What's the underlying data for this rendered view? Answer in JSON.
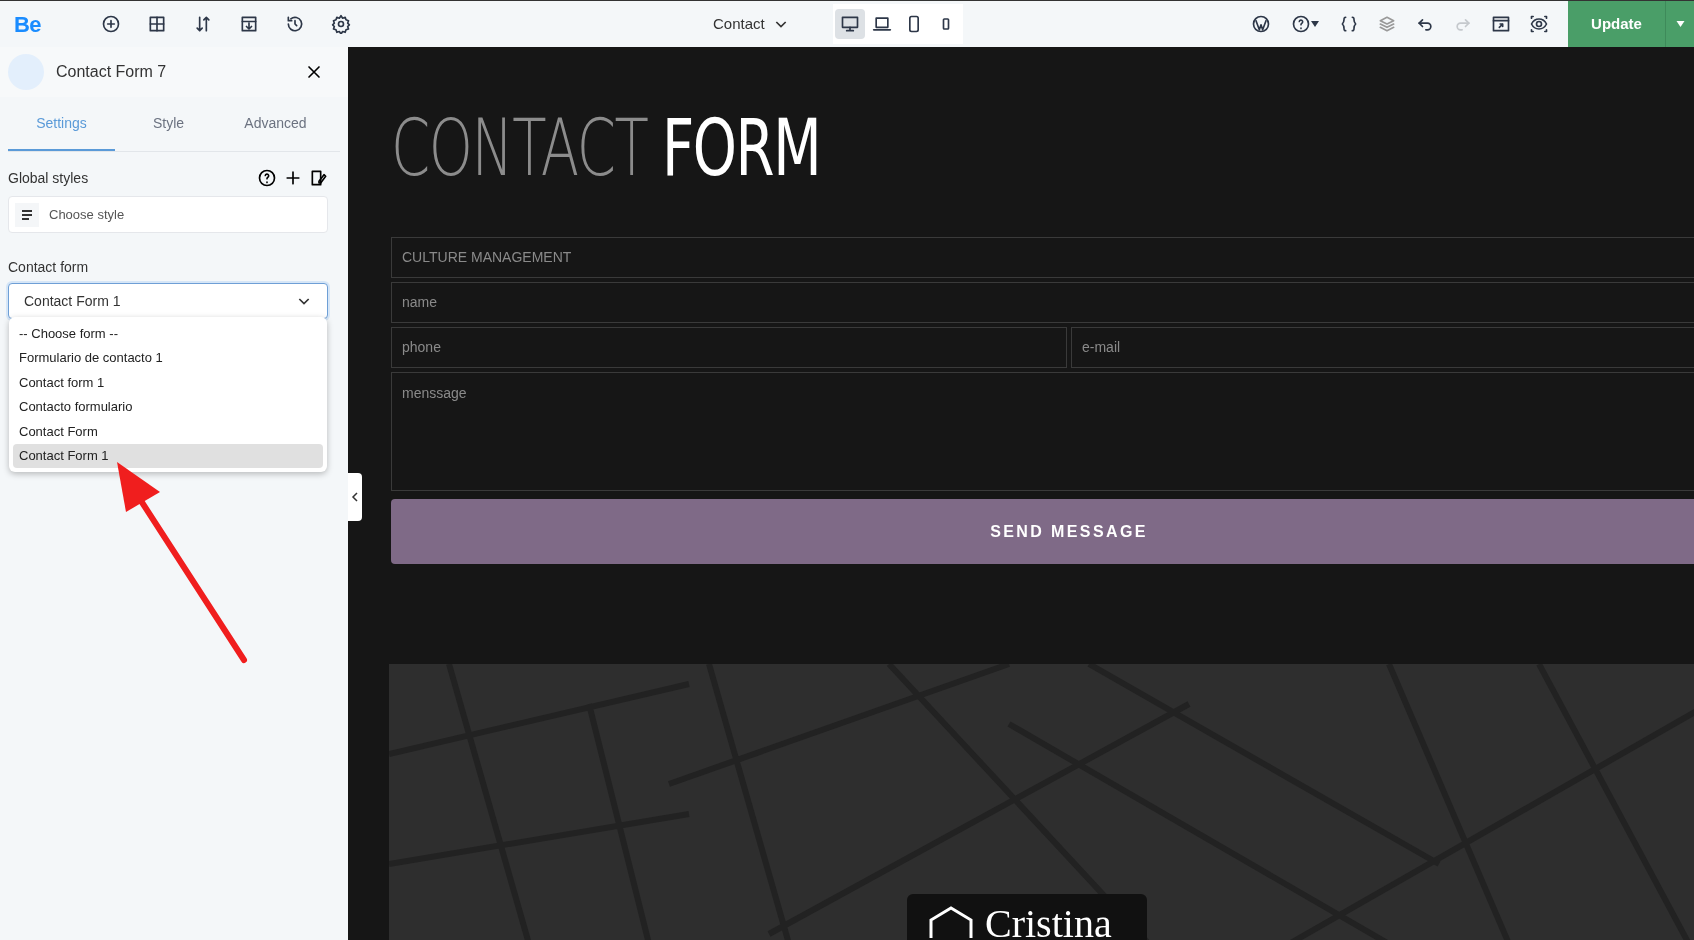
{
  "toolbar": {
    "logo": "Be",
    "page_selector": "Contact",
    "devices": [
      {
        "kind": "desktop",
        "selected": true
      },
      {
        "kind": "laptop",
        "selected": false
      },
      {
        "kind": "tablet",
        "selected": false
      },
      {
        "kind": "phone",
        "selected": false
      }
    ],
    "update_button": "Update"
  },
  "sidebar": {
    "title": "Contact Form 7",
    "tabs": [
      {
        "label": "Settings",
        "selected": true
      },
      {
        "label": "Style",
        "selected": false
      },
      {
        "label": "Advanced",
        "selected": false
      }
    ],
    "global_styles": {
      "label": "Global styles",
      "placeholder": "Choose style"
    },
    "contact_form": {
      "label": "Contact form",
      "value": "Contact Form 1",
      "expanded": true,
      "options": [
        {
          "label": "-- Choose form --",
          "selected": false
        },
        {
          "label": "Formulario de contacto 1",
          "selected": false
        },
        {
          "label": "Contact form 1",
          "selected": false
        },
        {
          "label": "Contacto formulario",
          "selected": false
        },
        {
          "label": "Contact Form",
          "selected": false
        },
        {
          "label": "Contact Form 1",
          "selected": true
        }
      ]
    }
  },
  "canvas": {
    "heading_light": "CONTACT",
    "heading_bold": "FORM",
    "fields": [
      {
        "kind": "full",
        "placeholder": "CULTURE MANAGEMENT"
      },
      {
        "kind": "full",
        "placeholder": "name"
      },
      {
        "kind": "half",
        "placeholder": "phone"
      },
      {
        "kind": "half",
        "placeholder": "e-mail"
      },
      {
        "kind": "textarea",
        "placeholder": "menssage"
      }
    ],
    "submit": "SEND MESSAGE",
    "map_card": "Cristina"
  }
}
